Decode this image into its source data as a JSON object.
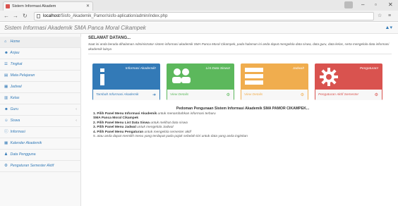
{
  "browser": {
    "tab_title": "Sistem Informasi Akadem",
    "url_host": "localhost",
    "url_path": "/Sisfo_Akademik_Pamor/sisfo-aplication/admin/index.php",
    "window_min": "–",
    "window_max": "▫",
    "window_close": "✕"
  },
  "app": {
    "title": "Sistem Informasi Akademik SMA Panca Moral Cikampek",
    "user_menu": "▲▾"
  },
  "sidebar": {
    "items": [
      {
        "label": "Home",
        "icon": "home-icon",
        "glyph": "⌂",
        "has_arrow": false
      },
      {
        "label": "Anjau",
        "icon": "user-icon",
        "glyph": "☻",
        "has_arrow": false
      },
      {
        "label": "Tingkat",
        "icon": "list-icon",
        "glyph": "☰",
        "has_arrow": false
      },
      {
        "label": "Mata Pelajaran",
        "icon": "book-icon",
        "glyph": "▤",
        "has_arrow": false
      },
      {
        "label": "Jadwal",
        "icon": "calendar-icon",
        "glyph": "▦",
        "has_arrow": false
      },
      {
        "label": "Kelas",
        "icon": "table-icon",
        "glyph": "▥",
        "has_arrow": false
      },
      {
        "label": "Guru",
        "icon": "user-icon",
        "glyph": "☻",
        "has_arrow": true
      },
      {
        "label": "Siswa",
        "icon": "users-icon",
        "glyph": "☺",
        "has_arrow": true
      },
      {
        "label": "Informasi",
        "icon": "info-icon",
        "glyph": "ⓘ",
        "has_arrow": false
      },
      {
        "label": "Kalender Akademik",
        "icon": "calendar-icon",
        "glyph": "▦",
        "has_arrow": false
      },
      {
        "label": "Data Pengguna",
        "icon": "user-icon",
        "glyph": "♟",
        "has_arrow": false
      },
      {
        "label": "Pengaturan Semester Aktif",
        "icon": "gear-icon",
        "glyph": "⚙",
        "has_arrow": false
      }
    ]
  },
  "main": {
    "welcome_title": "SELAMAT DATANG...",
    "welcome_text": "Saat ini anda berada dihalaman Administrator sistem informasi akademik SMA Panca Moral Cikampek, pada halaman ini anda dapat mengelola data siswa, data guru, data kelas, serta mengelola data informasi akademik lainya",
    "panels": [
      {
        "title": "Informasi Akademik!",
        "link": "Tambah Informasi Akademik",
        "color": "#337ab7",
        "link_color": "#337ab7"
      },
      {
        "title": "List Data Siswa!",
        "link": "View Details",
        "color": "#5cb85c",
        "link_color": "#5cb85c"
      },
      {
        "title": "Jadwal!",
        "link": "View Details",
        "color": "#f0ad4e",
        "link_color": "#f0ad4e"
      },
      {
        "title": "Pengaturan!",
        "link": "Pengaturan Aktif Semester",
        "color": "#d9534f",
        "link_color": "#d9534f"
      }
    ],
    "guide_title": "Pedoman Pengunaan Sistem Informasi Akademik SMA PAMOR CIKAMPEK...",
    "guide": [
      {
        "bold": "1. Pilih Panel Menu Informasi Akademik",
        "rest": " untuk menambahkan informasi terbaru"
      },
      {
        "bold": "    SMA Panca Moral Cikampek",
        "rest": ""
      },
      {
        "bold": "2. Pilih Panel Menu List Data Siswa",
        "rest": " untuk melihat data siswa"
      },
      {
        "bold": "3. Pilih Panel Menu Jadwal",
        "rest": " untuk mengelola Jadwal"
      },
      {
        "bold": "4. Pilih Panel Menu Pengaturan",
        "rest": " untuk mengelola semester aktif"
      },
      {
        "bold": "",
        "rest": "5. atau anda dapat memilih menu yang terdapat pada pojok sebelah kiri untuk data yang anda inginkan"
      }
    ]
  }
}
